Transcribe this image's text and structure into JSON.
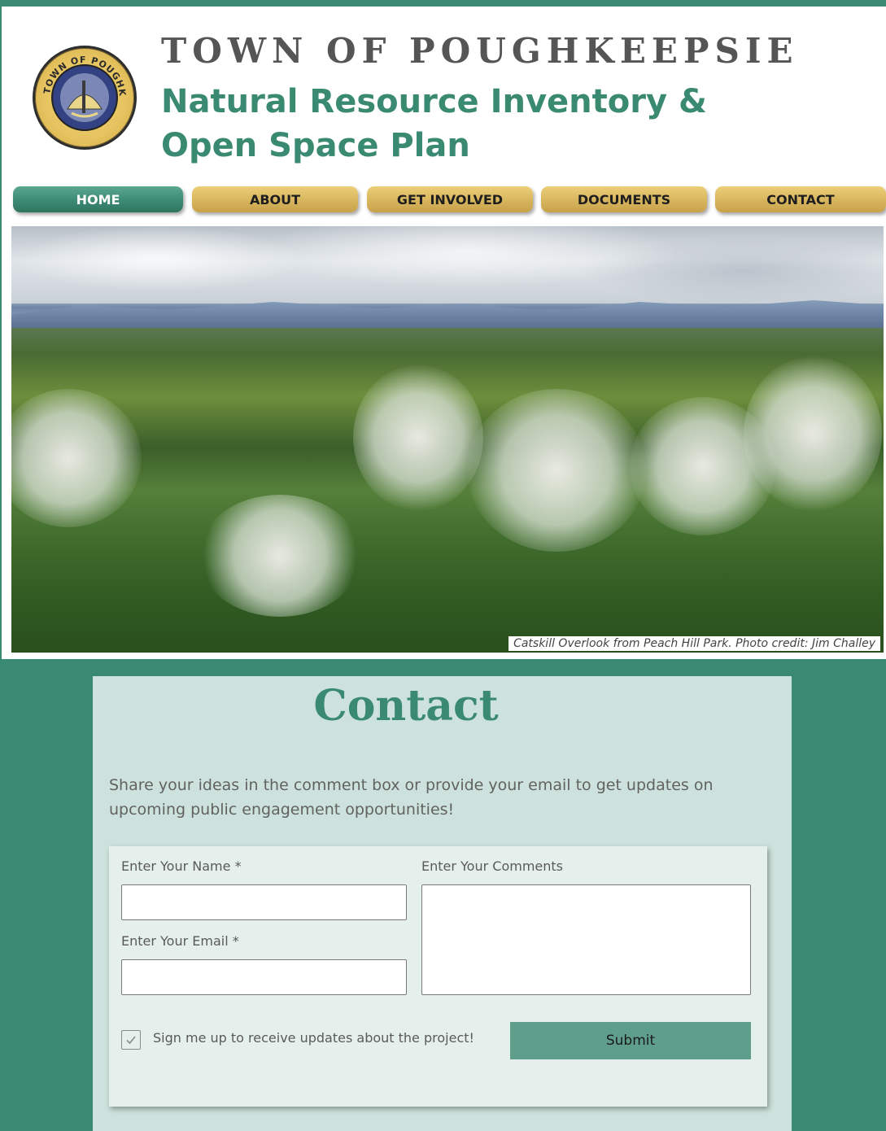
{
  "header": {
    "town_title": "TOWN OF POUGHKEEPSIE",
    "plan_title": "Natural Resource Inventory & Open Space Plan",
    "seal_text": "TOWN OF POUGHKEEPSIE NY"
  },
  "nav": {
    "items": [
      {
        "label": "HOME",
        "active": true
      },
      {
        "label": "ABOUT",
        "active": false
      },
      {
        "label": "GET INVOLVED",
        "active": false
      },
      {
        "label": "DOCUMENTS",
        "active": false
      },
      {
        "label": "CONTACT",
        "active": false
      }
    ]
  },
  "hero": {
    "caption": "Catskill Overlook from Peach Hill Park. Photo credit: Jim Challey"
  },
  "contact": {
    "title": "Contact",
    "description": "Share your ideas in the comment box or provide your email to get updates on upcoming public engagement opportunities!",
    "name_label": "Enter Your Name *",
    "email_label": "Enter Your Email *",
    "comments_label": "Enter Your Comments",
    "name_value": "",
    "email_value": "",
    "comments_value": "",
    "checkbox_label": "Sign me up to receive updates about the project!",
    "checkbox_checked": true,
    "submit_label": "Submit"
  },
  "colors": {
    "brand_green": "#3a8a72",
    "nav_gold": "#d7b55d",
    "panel_bg": "#cde2dc",
    "submit_bg": "#5f9e8b"
  }
}
